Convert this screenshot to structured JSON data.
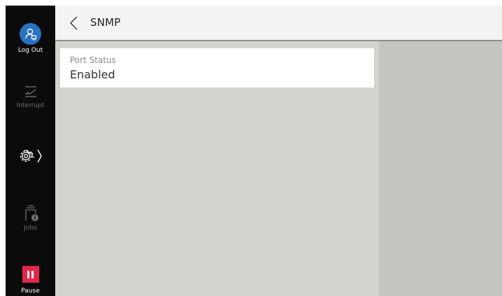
{
  "sidebar": {
    "logout_label": "Log Out",
    "interrupt_label": "Interrupt",
    "jobs_label": "Jobs",
    "pause_label": "Pause"
  },
  "header": {
    "title": "SNMP"
  },
  "settings_list": [
    {
      "label": "Port Status",
      "value": "Enabled"
    }
  ],
  "colors": {
    "rail": "#0b0b0b",
    "logout_accent": "#2a72c4",
    "pause_accent": "#e5264b",
    "content_bg": "#d3d4ce",
    "side_bg": "#c4c5c0"
  },
  "icons": {
    "logout": "user-logout-icon",
    "interrupt": "interrupt-icon",
    "settings": "gear-icon",
    "jobs": "jobs-info-icon",
    "pause": "pause-icon",
    "back": "chevron-left-icon"
  }
}
